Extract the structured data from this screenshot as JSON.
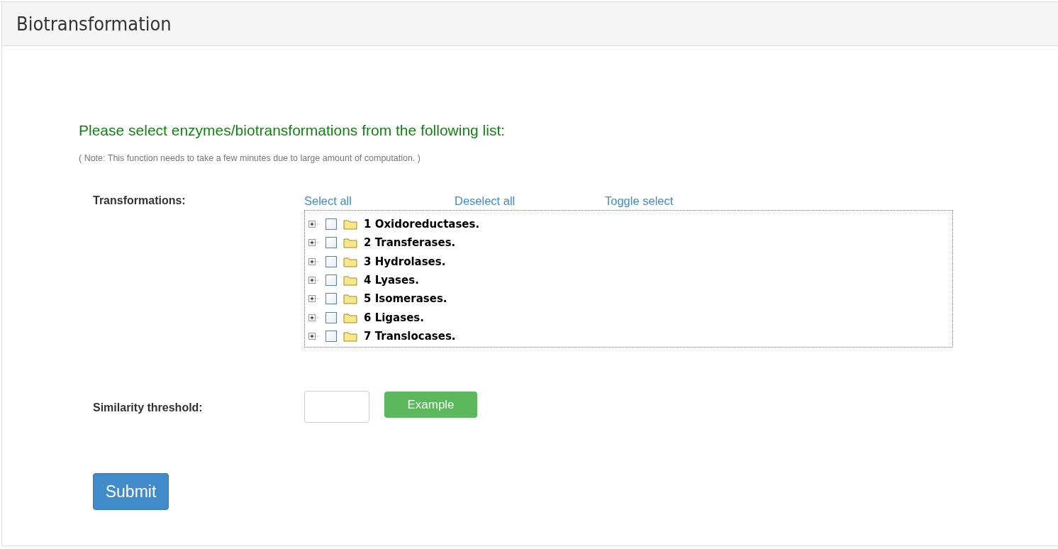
{
  "panel": {
    "title": "Biotransformation"
  },
  "heading": "Please select enzymes/biotransformations from the following list:",
  "note": "( Note: This function needs to take a few minutes due to large amount of computation. )",
  "transformations": {
    "label": "Transformations:",
    "links": [
      "Select all",
      "Deselect all",
      "Toggle select"
    ],
    "tree": [
      {
        "label": "1 Oxidoreductases.",
        "checked": false,
        "expanded": false
      },
      {
        "label": "2 Transferases.",
        "checked": false,
        "expanded": false
      },
      {
        "label": "3 Hydrolases.",
        "checked": false,
        "expanded": false
      },
      {
        "label": "4 Lyases.",
        "checked": false,
        "expanded": false
      },
      {
        "label": "5 Isomerases.",
        "checked": false,
        "expanded": false
      },
      {
        "label": "6 Ligases.",
        "checked": false,
        "expanded": false
      },
      {
        "label": "7 Translocases.",
        "checked": false,
        "expanded": false
      }
    ]
  },
  "similarity": {
    "label": "Similarity threshold:",
    "button": "Example"
  },
  "submit": "Submit"
}
